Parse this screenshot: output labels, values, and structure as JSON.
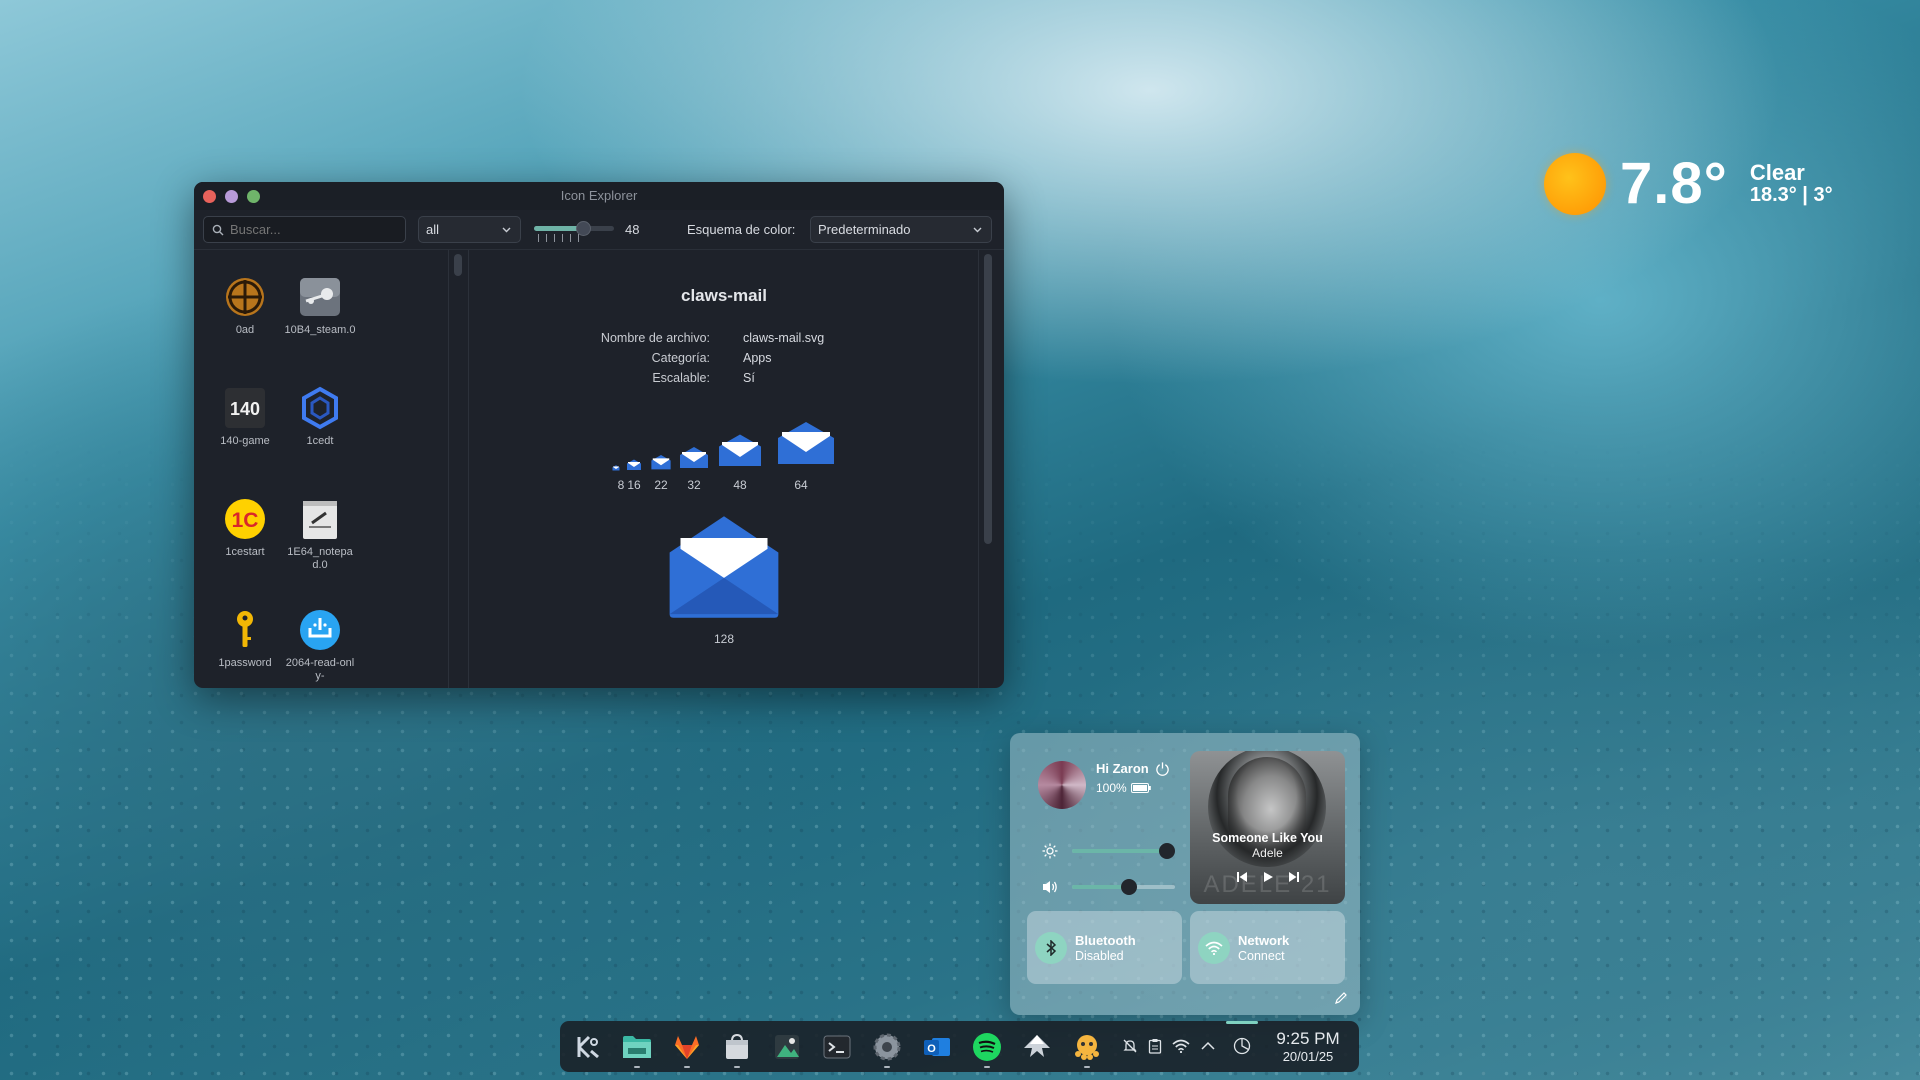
{
  "weather": {
    "temp": "7.8°",
    "condition": "Clear",
    "range": "18.3° | 3°"
  },
  "window": {
    "title": "Icon Explorer",
    "controls": {
      "close": "#e8625b",
      "minimize": "#b89ad8",
      "maximize": "#6fb46a"
    }
  },
  "toolbar": {
    "search_placeholder": "Buscar...",
    "filter_value": "all",
    "size_value": "48",
    "scheme_label": "Esquema de color:",
    "scheme_value": "Predeterminado"
  },
  "icon_list": [
    {
      "label": "0ad",
      "icon": "0ad-icon"
    },
    {
      "label": "10B4_steam.0",
      "icon": "steam-icon"
    },
    {
      "label": "140-game",
      "icon": "140-game-icon"
    },
    {
      "label": "1cedt",
      "icon": "1cedt-icon"
    },
    {
      "label": "1cestart",
      "icon": "1cestart-icon"
    },
    {
      "label": "1E64_notepad.0",
      "icon": "notepad-icon"
    },
    {
      "label": "1password",
      "icon": "key-icon"
    },
    {
      "label": "2064-read-only-",
      "icon": "read-only-icon"
    }
  ],
  "detail": {
    "name": "claws-mail",
    "fields": [
      {
        "key": "Nombre de archivo:",
        "value": "claws-mail.svg"
      },
      {
        "key": "Categoría:",
        "value": "Apps"
      },
      {
        "key": "Escalable:",
        "value": "Sí"
      }
    ],
    "sizes": [
      "8",
      "16",
      "22",
      "32",
      "48",
      "64"
    ],
    "large_size": "128"
  },
  "control_center": {
    "greeting": "Hi Zaron",
    "battery": "100%",
    "brightness": 0.92,
    "volume": 0.55,
    "media": {
      "song": "Someone Like You",
      "artist": "Adele",
      "watermark": "ADELE 21"
    },
    "bluetooth": {
      "title": "Bluetooth",
      "status": "Disabled"
    },
    "network": {
      "title": "Network",
      "status": "Connect"
    }
  },
  "dock": {
    "apps": [
      "kde-icon",
      "files-icon",
      "gitlab-icon",
      "store-icon",
      "image-viewer-icon",
      "terminal-icon",
      "settings-icon",
      "outlook-icon",
      "spotify-icon",
      "inkscape-icon",
      "octopi-icon"
    ],
    "time": "9:25 PM",
    "date": "20/01/25"
  }
}
